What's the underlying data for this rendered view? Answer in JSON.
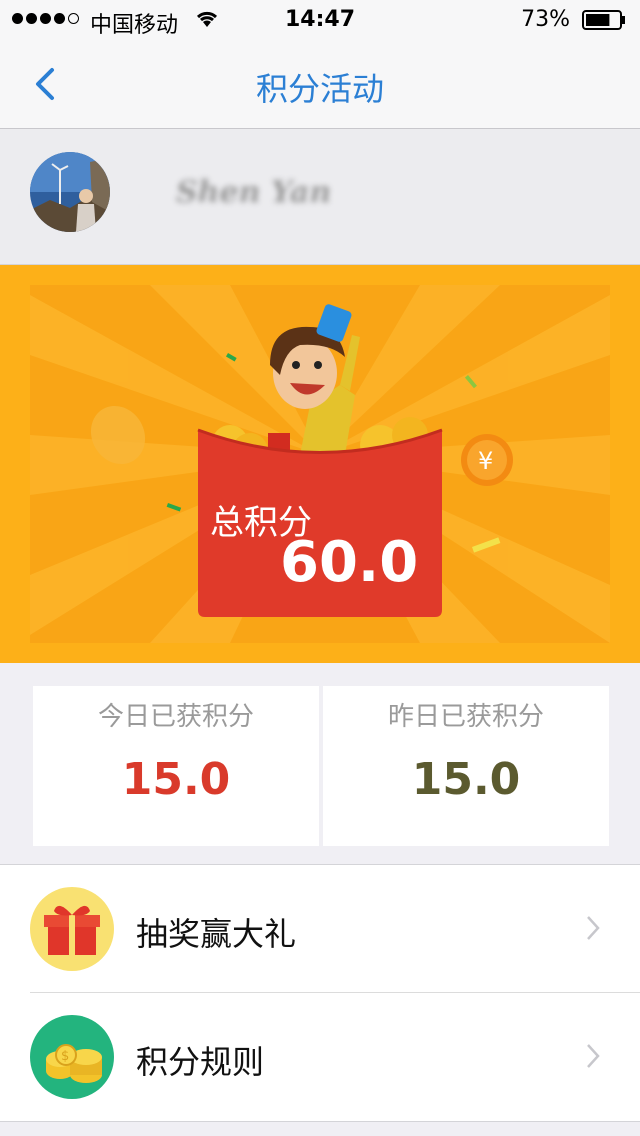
{
  "status_bar": {
    "carrier": "中国移动",
    "time": "14:47",
    "battery_percent": "73%",
    "battery_level": 0.73,
    "signal_bars": 4
  },
  "nav": {
    "title": "积分活动",
    "back_icon": "chevron-left-icon"
  },
  "profile": {
    "username": "Shen Yan"
  },
  "banner": {
    "total_label": "总积分",
    "total_value": "60.0"
  },
  "stats": {
    "today": {
      "label": "今日已获积分",
      "value": "15.0"
    },
    "yesterday": {
      "label": "昨日已获积分",
      "value": "15.0"
    }
  },
  "menu": {
    "items": [
      {
        "label": "抽奖赢大礼",
        "icon": "gift-icon"
      },
      {
        "label": "积分规则",
        "icon": "coins-icon"
      }
    ]
  },
  "colors": {
    "accent_blue": "#2b7fd4",
    "banner_orange": "#fdb018",
    "envelope_red": "#e03a2a",
    "today_value": "#d93a2b",
    "yesterday_value": "#5b5a2f"
  }
}
